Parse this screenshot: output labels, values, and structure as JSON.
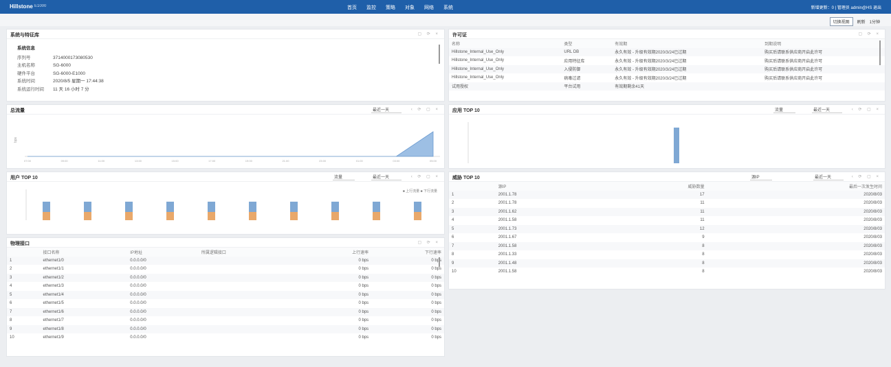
{
  "header": {
    "logo": "Hillstone",
    "model": "E1000",
    "nav": [
      "首页",
      "监控",
      "策略",
      "对象",
      "网络",
      "系统"
    ],
    "user": "新增更新：0 | 管理员 admin@HS 退出"
  },
  "subbar": {
    "btn1": "切换视图",
    "btn2": "刷新",
    "btn3": "1分钟"
  },
  "sysinfo": {
    "title": "系统与特征库",
    "heading": "系统信息",
    "rows": [
      {
        "k": "序列号",
        "v": "3714000173080530"
      },
      {
        "k": "主机名称",
        "v": "SG-6000"
      },
      {
        "k": "硬件平台",
        "v": "SG-6000-E1000"
      },
      {
        "k": "系统时间",
        "v": "2020/8/5 星期一 17:44:38"
      },
      {
        "k": "系统运行时间",
        "v": "11 天 16 小时 7 分"
      }
    ]
  },
  "license": {
    "title": "许可证",
    "headers": [
      "名称",
      "类型",
      "有效期",
      "到期说明"
    ],
    "rows": [
      [
        "Hillstone_Internal_Use_Only",
        "URL DB",
        "永久有效 - 升级有效期2020/3/24已过期",
        "购买后请联系供应商开启此许可"
      ],
      [
        "Hillstone_Internal_Use_Only",
        "应用特征库",
        "永久有效 - 升级有效期2020/3/24已过期",
        "购买后请联系供应商开启此许可"
      ],
      [
        "Hillstone_Internal_Use_Only",
        "入侵防御",
        "永久有效 - 升级有效期2020/3/24已过期",
        "购买后请联系供应商开启此许可"
      ],
      [
        "Hillstone_Internal_Use_Only",
        "病毒过滤",
        "永久有效 - 升级有效期2020/3/24已过期",
        "购买后请联系供应商开启此许可"
      ],
      [
        "试用授权",
        "平台试用",
        "有效期剩余41天",
        ""
      ]
    ]
  },
  "traffic": {
    "title": "总流量",
    "range": "最近一天",
    "ylabel": "bps"
  },
  "apptop": {
    "title": "应用 TOP 10",
    "metric": "流量",
    "range": "最近一天"
  },
  "usertop": {
    "title": "用户 TOP 10",
    "metric": "流量",
    "range": "最近一天",
    "legend": [
      "上行流量",
      "下行流量"
    ]
  },
  "threat": {
    "title": "威胁 TOP 10",
    "filter": "源IP",
    "range": "最近一天",
    "headers": [
      "",
      "源IP",
      "威胁数量",
      "最后一次发生时间"
    ],
    "rows": [
      [
        "1",
        "2001.1.78",
        "17",
        "2020/8/03"
      ],
      [
        "2",
        "2001.1.78",
        "11",
        "2020/8/03"
      ],
      [
        "3",
        "2001.1.62",
        "11",
        "2020/8/03"
      ],
      [
        "4",
        "2001.1.58",
        "11",
        "2020/8/03"
      ],
      [
        "5",
        "2001.1.73",
        "12",
        "2020/8/03"
      ],
      [
        "6",
        "2001.1.67",
        "9",
        "2020/8/03"
      ],
      [
        "7",
        "2001.1.58",
        "8",
        "2020/8/03"
      ],
      [
        "8",
        "2001.1.33",
        "8",
        "2020/8/03"
      ],
      [
        "9",
        "2001.1.48",
        "8",
        "2020/8/03"
      ],
      [
        "10",
        "2001.1.58",
        "8",
        "2020/8/03"
      ]
    ]
  },
  "ports": {
    "title": "物理接口",
    "headers": [
      "",
      "接口名称",
      "IP地址",
      "所属逻辑接口",
      "上行速率",
      "下行速率"
    ],
    "rows": [
      [
        "1",
        "ethernet1/0",
        "0.0.0.0/0",
        "",
        "0 bps",
        "0 bps"
      ],
      [
        "2",
        "ethernet1/1",
        "0.0.0.0/0",
        "",
        "0 bps",
        "0 bps"
      ],
      [
        "3",
        "ethernet1/2",
        "0.0.0.0/0",
        "",
        "0 bps",
        "0 bps"
      ],
      [
        "4",
        "ethernet1/3",
        "0.0.0.0/0",
        "",
        "0 bps",
        "0 bps"
      ],
      [
        "5",
        "ethernet1/4",
        "0.0.0.0/0",
        "",
        "0 bps",
        "0 bps"
      ],
      [
        "6",
        "ethernet1/5",
        "0.0.0.0/0",
        "",
        "0 bps",
        "0 bps"
      ],
      [
        "7",
        "ethernet1/6",
        "0.0.0.0/0",
        "",
        "0 bps",
        "0 bps"
      ],
      [
        "8",
        "ethernet1/7",
        "0.0.0.0/0",
        "",
        "0 bps",
        "0 bps"
      ],
      [
        "9",
        "ethernet1/8",
        "0.0.0.0/0",
        "",
        "0 bps",
        "0 bps"
      ],
      [
        "10",
        "ethernet1/9",
        "0.0.0.0/0",
        "",
        "0 bps",
        "0 bps"
      ]
    ]
  },
  "chart_data": [
    {
      "type": "area",
      "title": "总流量",
      "x": [
        "07:00",
        "09:00",
        "11:00",
        "13:00",
        "15:00",
        "17:00",
        "19:00",
        "21:00",
        "23:00",
        "01:00",
        "03:00",
        "05:00"
      ],
      "values": [
        0,
        0,
        0,
        0,
        0,
        0,
        0,
        0,
        0,
        0,
        0,
        2.4
      ]
    },
    {
      "type": "bar",
      "title": "应用 TOP 10",
      "categories": [
        "APP"
      ],
      "values": [
        1
      ]
    },
    {
      "type": "bar",
      "title": "用户 TOP 10",
      "categories": [
        "U1",
        "U2",
        "U3",
        "U4",
        "U5",
        "U6",
        "U7",
        "U8",
        "U9",
        "U10"
      ],
      "series": [
        {
          "name": "上行流量",
          "values": [
            3,
            3,
            3,
            3,
            3,
            3,
            3,
            3,
            3,
            3
          ]
        },
        {
          "name": "下行流量",
          "values": [
            2.4,
            2.4,
            2.4,
            2.4,
            2.4,
            2.4,
            2.4,
            2.4,
            2.4,
            2.4
          ]
        }
      ]
    }
  ]
}
